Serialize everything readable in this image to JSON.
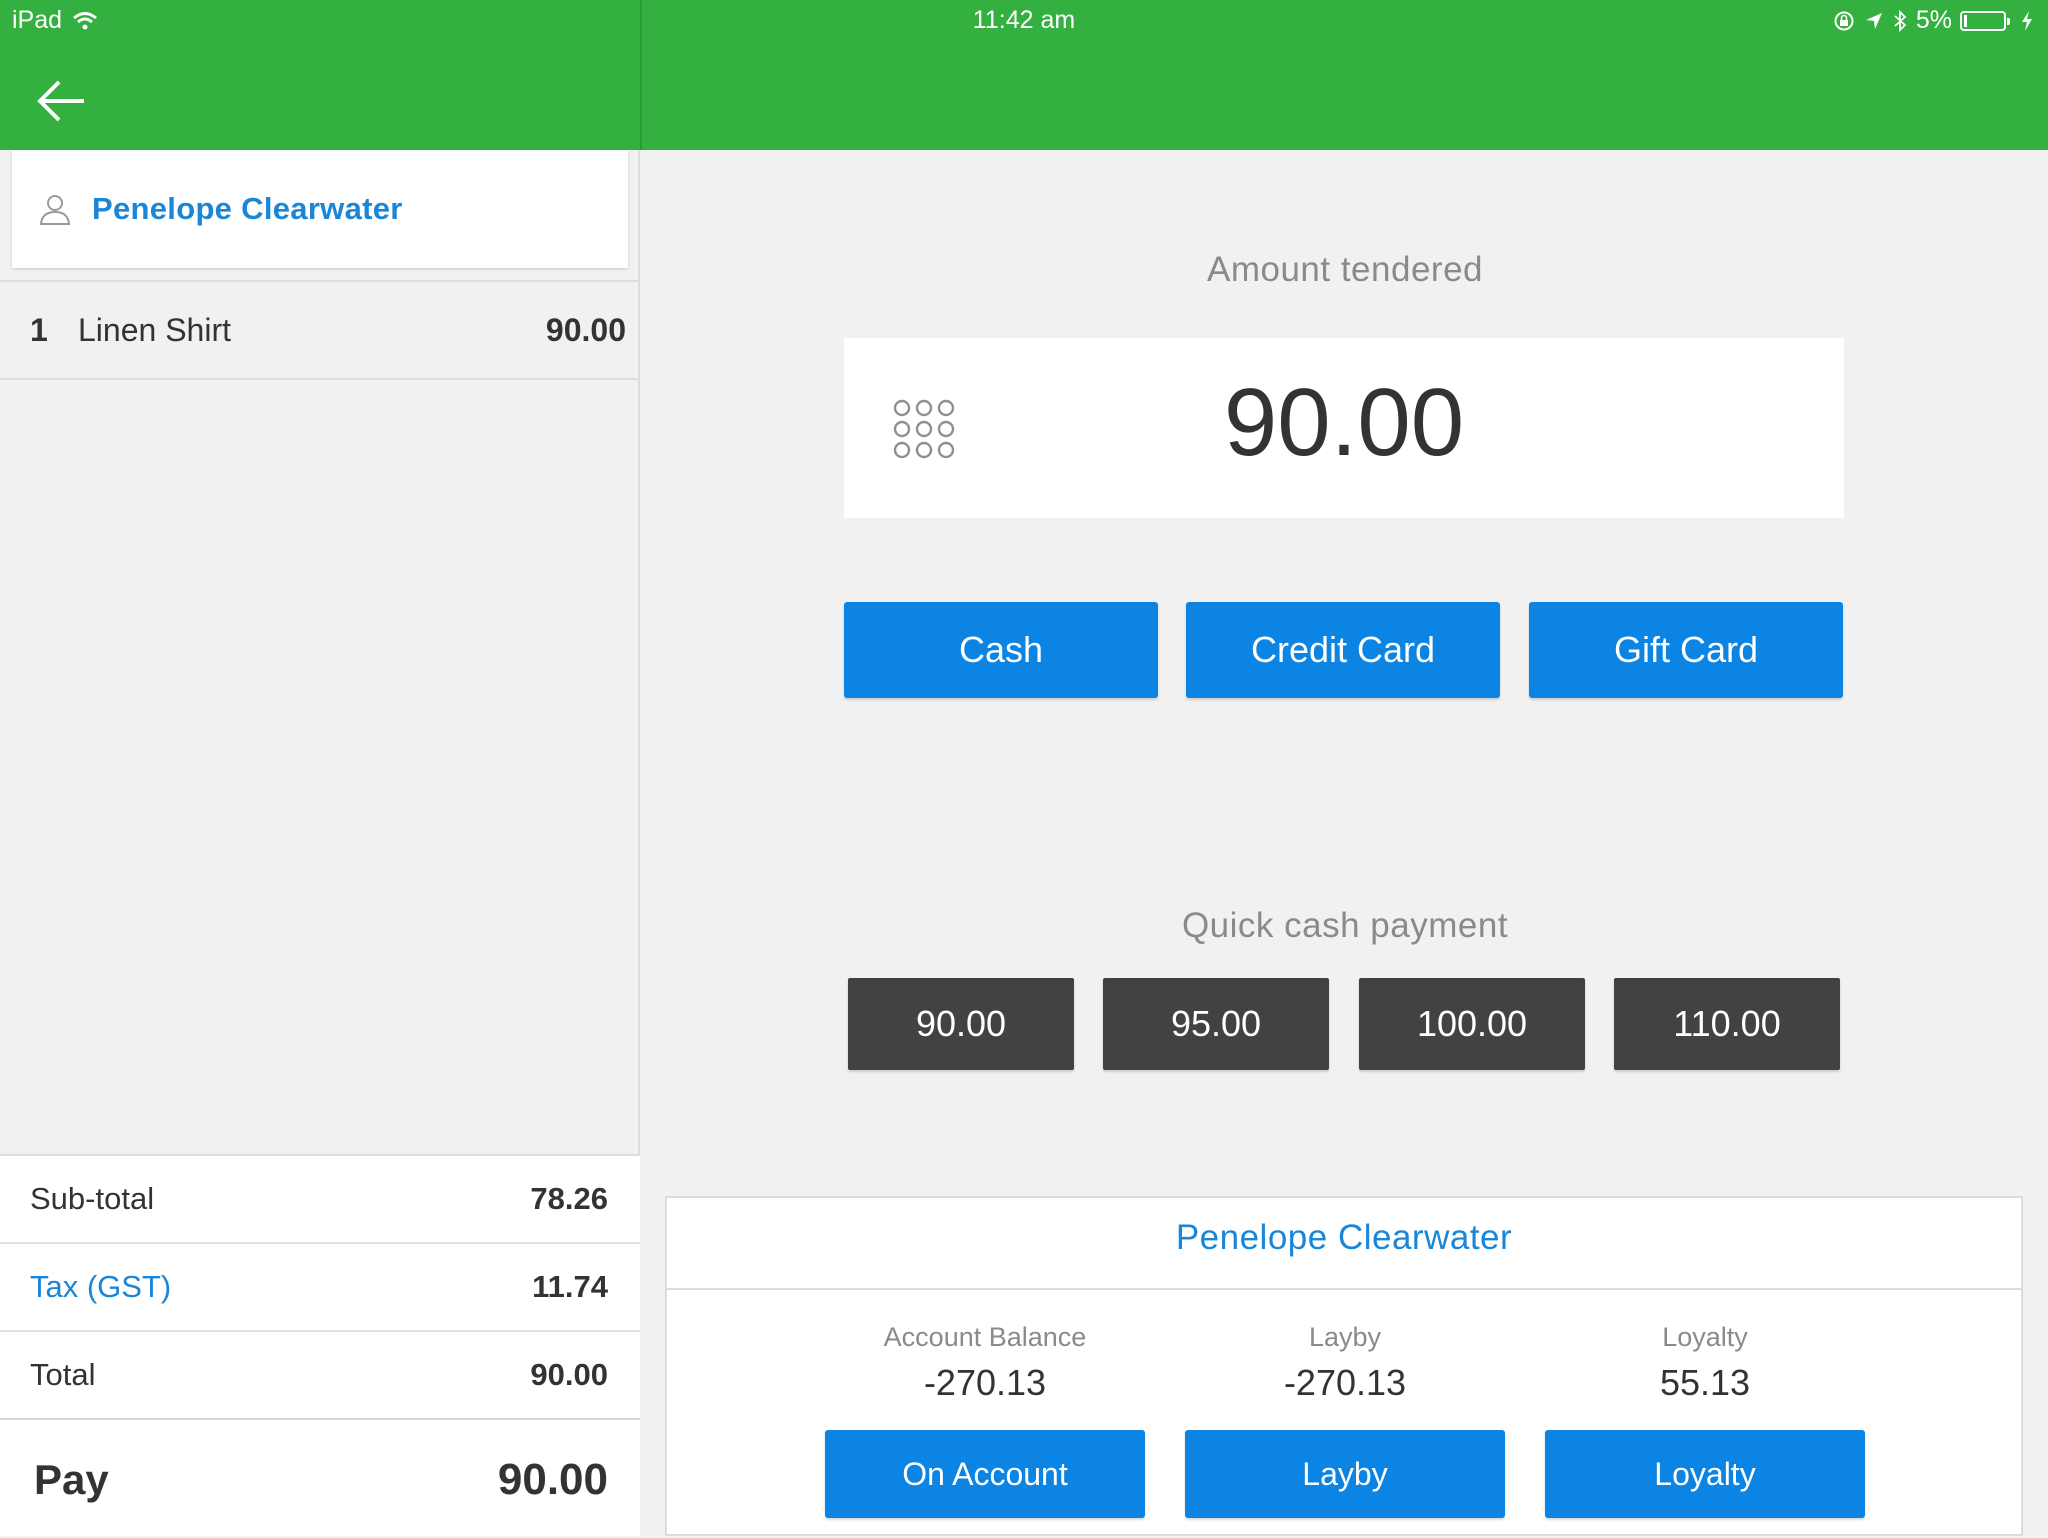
{
  "status_bar": {
    "device": "iPad",
    "time": "11:42 am",
    "battery": "5%",
    "icons": [
      "wifi-icon",
      "rotation-lock-icon",
      "location-icon",
      "bluetooth-icon",
      "battery-icon",
      "charging-icon"
    ]
  },
  "colors": {
    "header_green": "#34b041",
    "accent_blue": "#0b84e3",
    "link_blue": "#1a86d8",
    "quick_button": "#424242"
  },
  "sale": {
    "customer": "Penelope  Clearwater",
    "lines": [
      {
        "qty": "1",
        "name": "Linen Shirt",
        "price": "90.00"
      }
    ],
    "subtotal_label": "Sub-total",
    "subtotal": "78.26",
    "tax_label": "Tax (GST)",
    "tax": "11.74",
    "total_label": "Total",
    "total": "90.00",
    "pay_label": "Pay",
    "pay": "90.00"
  },
  "payment": {
    "amount_label": "Amount tendered",
    "amount": "90.00",
    "methods": [
      "Cash",
      "Credit Card",
      "Gift Card"
    ],
    "quick_label": "Quick cash payment",
    "quick_amounts": [
      "90.00",
      "95.00",
      "100.00",
      "110.00"
    ]
  },
  "account": {
    "customer": "Penelope  Clearwater",
    "stats": [
      {
        "label": "Account Balance",
        "value": "-270.13",
        "button": "On Account"
      },
      {
        "label": "Layby",
        "value": "-270.13",
        "button": "Layby"
      },
      {
        "label": "Loyalty",
        "value": "55.13",
        "button": "Loyalty"
      }
    ]
  }
}
